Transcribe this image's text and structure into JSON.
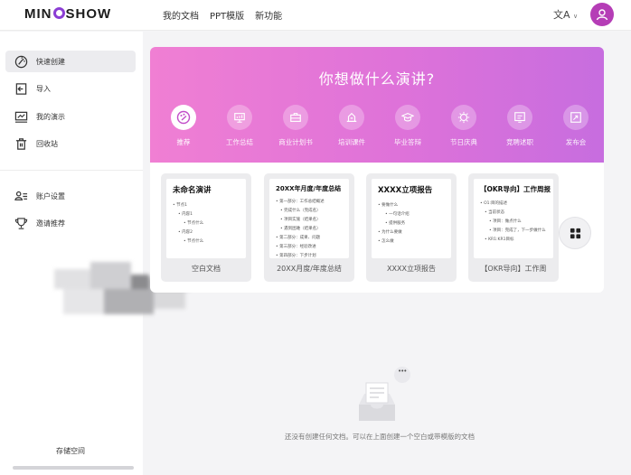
{
  "header": {
    "logo_pre": "MIN",
    "logo_post": "SHOW",
    "nav": [
      "我的文档",
      "PPT模版",
      "新功能"
    ],
    "lang_glyph": "文A",
    "lang_chevron": "∨"
  },
  "sidebar": {
    "items": [
      {
        "label": "快速创建",
        "icon": "wand-icon",
        "active": true
      },
      {
        "label": "导入",
        "icon": "import-icon",
        "active": false
      },
      {
        "label": "我的演示",
        "icon": "presentation-icon",
        "active": false
      },
      {
        "label": "回收站",
        "icon": "trash-icon",
        "active": false
      },
      {
        "label": "账户设置",
        "icon": "account-icon",
        "active": false
      },
      {
        "label": "邀请推荐",
        "icon": "trophy-icon",
        "active": false
      }
    ],
    "storage_label": "存储空间",
    "storage_used_fraction": 0
  },
  "banner": {
    "title": "你想做什么演讲?",
    "categories": [
      {
        "label": "推荐",
        "icon": "palette-icon",
        "active": true
      },
      {
        "label": "工作总结",
        "icon": "monitor-icon",
        "active": false
      },
      {
        "label": "商业计划书",
        "icon": "business-icon",
        "active": false
      },
      {
        "label": "培训课件",
        "icon": "training-icon",
        "active": false
      },
      {
        "label": "毕业答辩",
        "icon": "graduation-icon",
        "active": false
      },
      {
        "label": "节日庆典",
        "icon": "celebration-icon",
        "active": false
      },
      {
        "label": "竞聘述职",
        "icon": "report-icon",
        "active": false
      },
      {
        "label": "发布会",
        "icon": "launch-icon",
        "active": false
      }
    ]
  },
  "templates": [
    {
      "title": "未命名演讲",
      "caption": "空白文档",
      "lines": [
        "• 节点1",
        "• 内容1",
        "• 节点什么",
        "• 内容2",
        "• 节点什么"
      ]
    },
    {
      "title": "20XX年月度/年度总结",
      "caption": "20XX月度/年度总结",
      "lines": [
        "• 第一部分：工作总结概述",
        "• 完成什么（完成名）",
        "• 项目实施（结果名）",
        "• 遇到困难（结果名）",
        "• 第二部分：成果、问题",
        "• 第三部分：经验改进",
        "• 第四部分：下步计划"
      ]
    },
    {
      "title": "XXXX立项报告",
      "caption": "XXXX立项报告",
      "lines": [
        "• 要做什么",
        "• 一句话介绍",
        "• 提供服务",
        "• 为什么要做",
        "• 怎么做"
      ]
    },
    {
      "title": "【OKR导向】工作周报",
      "caption": "【OKR导向】工作周",
      "lines": [
        "• O1:目的描述",
        "• 当前状态",
        "• 项目：做点什么",
        "• 项目：完成了，下一步做什么",
        "• KR1:KR1目标"
      ]
    }
  ],
  "empty_state": {
    "message": "还没有创建任何文档。可以在上面创建一个空白或带模版的文档",
    "bubble": "•••"
  },
  "colors": {
    "accent": "#b53db6",
    "banner_start": "#f07fd3",
    "banner_end": "#c76ddf"
  }
}
